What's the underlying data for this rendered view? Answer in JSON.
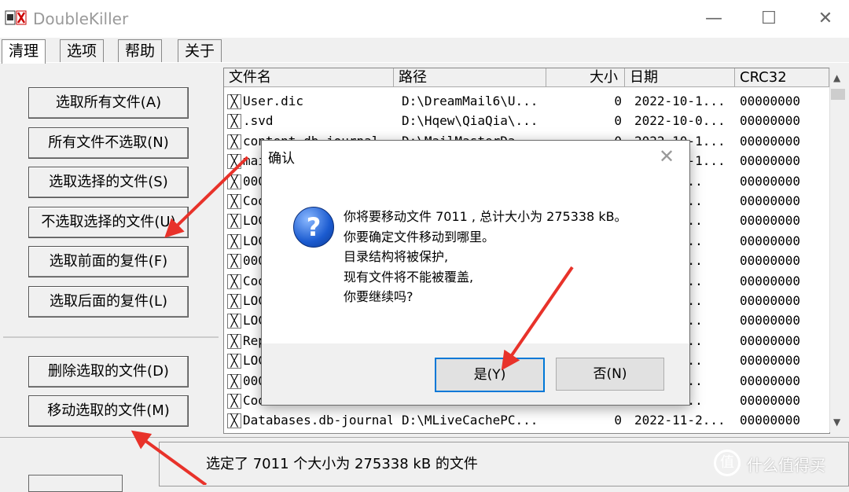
{
  "window": {
    "title": "DoubleKiller",
    "minimize": "—",
    "maximize": "☐",
    "close": "✕"
  },
  "tabs": [
    "清理",
    "选项",
    "帮助",
    "关于"
  ],
  "left_buttons": {
    "select_all": "选取所有文件(A)",
    "deselect_all": "所有文件不选取(N)",
    "select_selected": "选取选择的文件(S)",
    "deselect_selected": "不选取选择的文件(U)",
    "select_front_dups": "选取前面的复件(F)",
    "select_back_dups": "选取后面的复件(L)",
    "delete_selected": "删除选取的文件(D)",
    "move_selected": "移动选取的文件(M)"
  },
  "list": {
    "columns": [
      "文件名",
      "路径",
      "大小",
      "日期",
      "CRC32"
    ],
    "rows": [
      {
        "name": "User.dic",
        "path": "D:\\DreamMail6\\U...",
        "size": "0",
        "date": "2022-10-1...",
        "crc": "00000000"
      },
      {
        "name": ".svd",
        "path": "D:\\Hqew\\QiaQia\\...",
        "size": "0",
        "date": "2022-10-0...",
        "crc": "00000000"
      },
      {
        "name": "content.db-journal",
        "path": "D:\\MailMasterDa...",
        "size": "0",
        "date": "2022-10-1...",
        "crc": "00000000"
      },
      {
        "name": "main.db-journal",
        "path": "",
        "size": "",
        "date": "2022-10-1...",
        "crc": "00000000"
      },
      {
        "name": "000",
        "path": "",
        "size": "",
        "date": "2022-2...",
        "crc": "00000000"
      },
      {
        "name": "Coo",
        "path": "",
        "size": "",
        "date": "2022-2...",
        "crc": "00000000"
      },
      {
        "name": "LOC",
        "path": "",
        "size": "",
        "date": "2022-2...",
        "crc": "00000000"
      },
      {
        "name": "LOC",
        "path": "",
        "size": "",
        "date": "2022-2...",
        "crc": "00000000"
      },
      {
        "name": "000",
        "path": "",
        "size": "",
        "date": "2022-2...",
        "crc": "00000000"
      },
      {
        "name": "Coo",
        "path": "",
        "size": "",
        "date": "2022-2...",
        "crc": "00000000"
      },
      {
        "name": "LOC",
        "path": "",
        "size": "",
        "date": "2022-2...",
        "crc": "00000000"
      },
      {
        "name": "LOC",
        "path": "",
        "size": "",
        "date": "2022-2...",
        "crc": "00000000"
      },
      {
        "name": "Rep",
        "path": "",
        "size": "",
        "date": "2022-2...",
        "crc": "00000000"
      },
      {
        "name": "LOC",
        "path": "",
        "size": "",
        "date": "2022-2...",
        "crc": "00000000"
      },
      {
        "name": "000",
        "path": "",
        "size": "",
        "date": "2022-2...",
        "crc": "00000000"
      },
      {
        "name": "Coo",
        "path": "",
        "size": "",
        "date": "2022-2...",
        "crc": "00000000"
      },
      {
        "name": "Databases.db-journal",
        "path": "D:\\MLiveCachePC...",
        "size": "0",
        "date": "2022-11-2...",
        "crc": "00000000"
      }
    ]
  },
  "status": {
    "text": "选定了 7011 个大小为 275338 kB 的文件"
  },
  "watermark": {
    "logo": "值",
    "text": "什么值得买"
  },
  "dialog": {
    "title": "确认",
    "close": "✕",
    "icon": "?",
    "lines": [
      "你将要移动文件 7011 , 总计大小为 275338 kB。",
      "你要确定文件移动到哪里。",
      "目录结构将被保护,",
      "现有文件将不能被覆盖,",
      "你要继续吗?"
    ],
    "yes": "是(Y)",
    "no": "否(N)"
  },
  "colors": {
    "accent": "#0078d7",
    "annotation": "#e8322a",
    "dialog_icon": "#1b5bd0"
  }
}
